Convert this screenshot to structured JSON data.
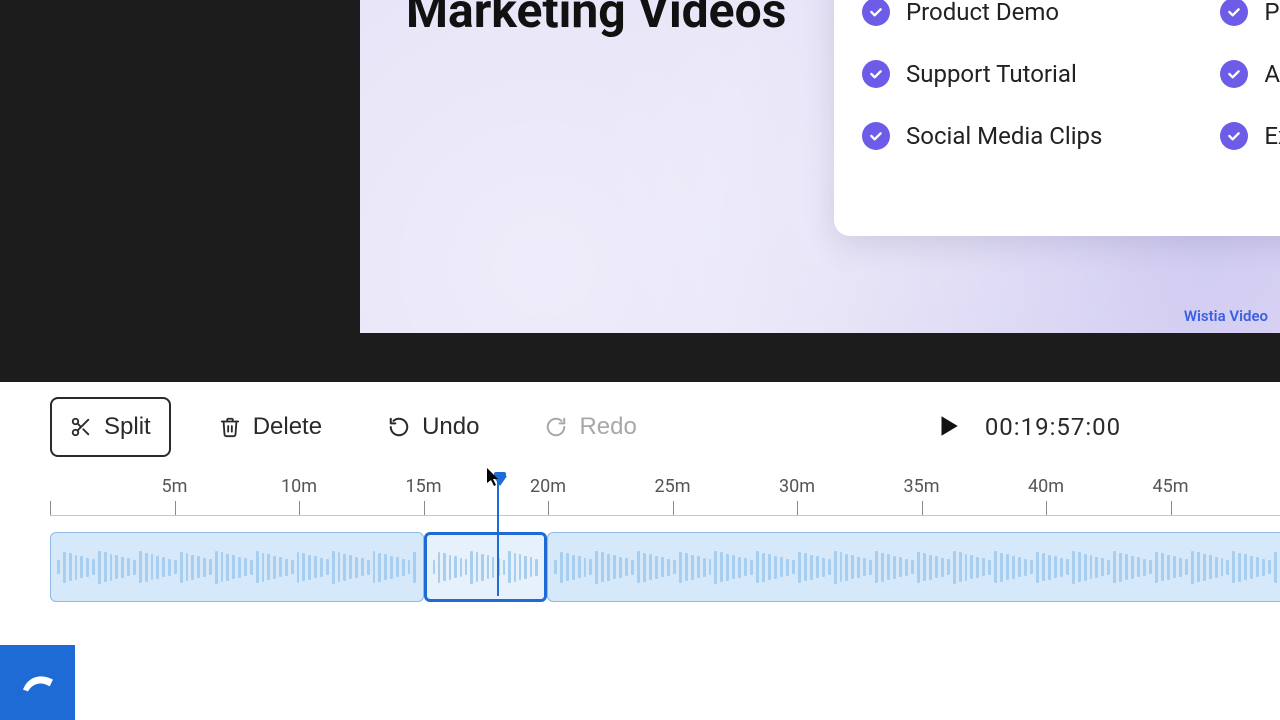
{
  "preview": {
    "title_line1": "Marketing Videos",
    "card": {
      "col1": [
        "Product Demo",
        "Support Tutorial",
        "Social Media Clips"
      ],
      "col2": [
        "Podcast",
        "Animation",
        "Explainer"
      ]
    },
    "watermark": "Wistia Video"
  },
  "toolbar": {
    "split_label": "Split",
    "delete_label": "Delete",
    "undo_label": "Undo",
    "redo_label": "Redo",
    "timecode": "00:19:57:00"
  },
  "timeline": {
    "tick_interval_min": 5,
    "ticks_labeled": [
      "5m",
      "10m",
      "15m",
      "20m",
      "25m",
      "30m",
      "35m",
      "40m",
      "45m"
    ],
    "playhead_min": 19.95,
    "clips": [
      {
        "start_min": 0,
        "end_min": 15,
        "selected": false
      },
      {
        "start_min": 15,
        "end_min": 19.95,
        "selected": true
      },
      {
        "start_min": 19.95,
        "end_min": 50,
        "selected": false
      }
    ]
  },
  "colors": {
    "accent": "#1f6bd6",
    "check": "#6c5ce7",
    "clip_bg": "#d6e9fb"
  }
}
